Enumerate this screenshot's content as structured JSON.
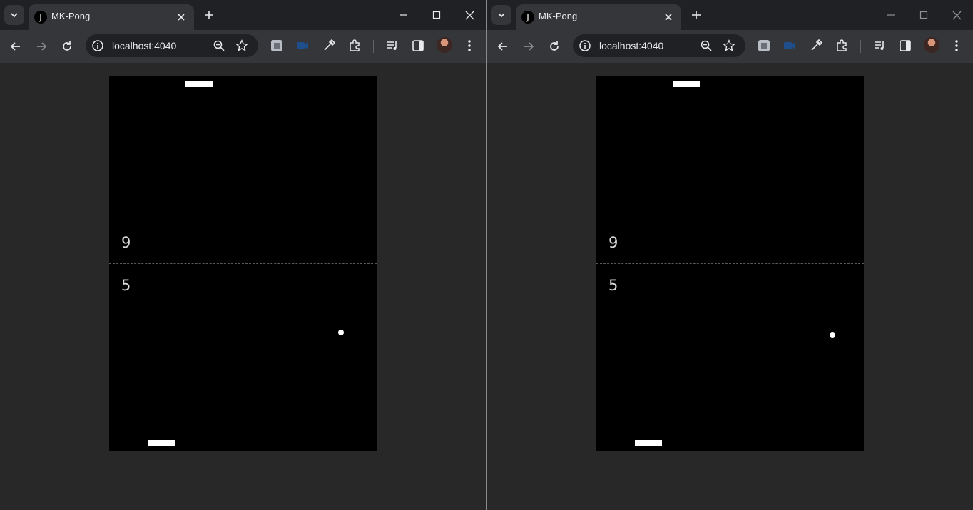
{
  "windows": [
    {
      "tab": {
        "favicon_letter": "J",
        "title": "MK-Pong"
      },
      "url": "localhost:4040",
      "game": {
        "score_top": "9",
        "score_bottom": "5"
      }
    },
    {
      "tab": {
        "favicon_letter": "J",
        "title": "MK-Pong"
      },
      "url": "localhost:4040",
      "game": {
        "score_top": "9",
        "score_bottom": "5"
      }
    }
  ],
  "icons": [
    "tab-search-icon",
    "close-icon",
    "plus-icon",
    "minimize-icon",
    "maximize-icon",
    "back-arrow-icon",
    "forward-arrow-icon",
    "reload-icon",
    "info-icon",
    "zoom-icon",
    "star-icon",
    "extension-icon",
    "eyedropper-icon",
    "puzzle-icon",
    "media-icon",
    "side-panel-icon",
    "avatar",
    "more-icon"
  ],
  "colors": {
    "page_bg": "#282828",
    "court_bg": "#000000",
    "chrome_tabbar": "#202124",
    "chrome_toolbar": "#35363a"
  }
}
